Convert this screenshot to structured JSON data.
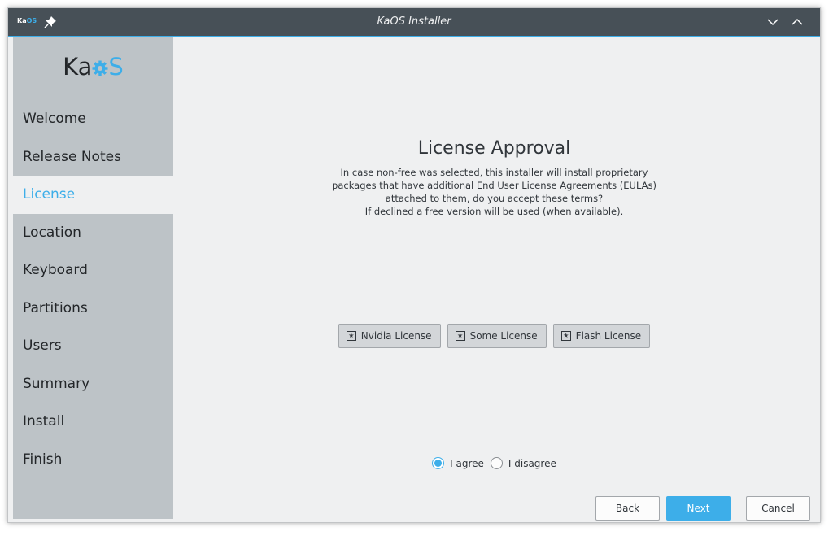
{
  "window": {
    "title": "KaOS Installer",
    "logo_text_1": "Ka",
    "logo_text_2": "OS"
  },
  "sidebar": {
    "brand_ka": "Ka",
    "brand_s": "S",
    "items": [
      {
        "label": "Welcome"
      },
      {
        "label": "Release Notes"
      },
      {
        "label": "License"
      },
      {
        "label": "Location"
      },
      {
        "label": "Keyboard"
      },
      {
        "label": "Partitions"
      },
      {
        "label": "Users"
      },
      {
        "label": "Summary"
      },
      {
        "label": "Install"
      },
      {
        "label": "Finish"
      }
    ],
    "active": "License"
  },
  "main": {
    "heading": "License Approval",
    "desc_lines": [
      "In case non-free was selected, this installer will install proprietary",
      "packages that have additional End User License Agreements (EULAs)",
      "attached to them, do you accept these terms?",
      "If declined a free version will be used (when available)."
    ],
    "licenses": [
      {
        "label": "Nvidia License"
      },
      {
        "label": "Some License"
      },
      {
        "label": "Flash License"
      }
    ],
    "radio_agree": "I agree",
    "radio_disagree": "I disagree",
    "selected": "I agree"
  },
  "buttons": {
    "back": "Back",
    "next": "Next",
    "cancel": "Cancel"
  },
  "colors": {
    "accent": "#3daee9",
    "titlebar": "#475057",
    "sidebar": "#bdc3c7"
  }
}
